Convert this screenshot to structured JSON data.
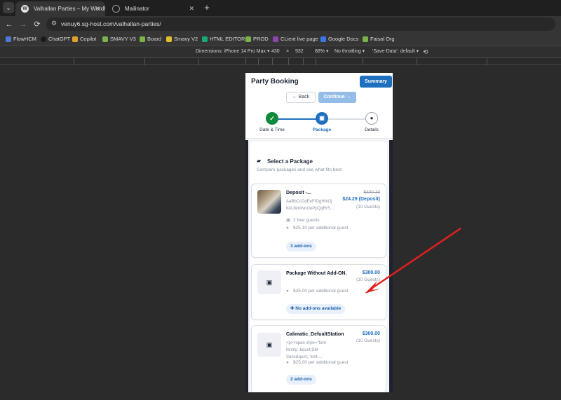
{
  "browser": {
    "tabs": [
      {
        "title": "Valhallan Parties – My WordPre",
        "icon": "wordpress-icon",
        "active": true
      },
      {
        "title": "Mailinator",
        "icon": "globe-icon",
        "active": false
      }
    ],
    "close_glyph": "✕",
    "new_tab_glyph": "+",
    "menu_glyph": "⌄",
    "url": "venuy6.sg-host.com/valhallan-parties/",
    "bookmarks": [
      {
        "label": "FlowHCM",
        "color": "#4b7bd6"
      },
      {
        "label": "ChatGPT",
        "color": "#1a1a1a"
      },
      {
        "label": "Copilot",
        "color": "#e0a02b"
      },
      {
        "label": "SMAVY V3",
        "color": "#7bb34a"
      },
      {
        "label": "Board",
        "color": "#7bb34a"
      },
      {
        "label": "Smavy V2",
        "color": "#e0c030"
      },
      {
        "label": "HTML EDITOR",
        "color": "#19a974"
      },
      {
        "label": "PROD",
        "color": "#7bb34a"
      },
      {
        "label": "CLient live page",
        "color": "#8e44ad"
      },
      {
        "label": "Google Docs",
        "color": "#3b78e7"
      },
      {
        "label": "Faisal Org",
        "color": "#7bb34a"
      }
    ]
  },
  "devtools": {
    "dimensions": "Dimensions: iPhone 14 Pro Max ▾",
    "width": "430",
    "times": "×",
    "height": "932",
    "zoom": "88% ▾",
    "throttle": "No throttling ▾",
    "save_data": "'Save-Data': default ▾"
  },
  "page": {
    "title": "Party Booking",
    "summary_button": "Summary",
    "back_button": "← Back",
    "continue_button": "Continue →",
    "steps": [
      {
        "label": "Date & Time",
        "state": "done"
      },
      {
        "label": "Package",
        "state": "active"
      },
      {
        "label": "Details",
        "state": "pending"
      }
    ],
    "section_title": "Select a Package",
    "section_subtitle": "Compare packages and see what fits best.",
    "packages": [
      {
        "name": "Deposit -...",
        "description": "AaBbCcDdEeFfGgHhIiJj KkLlMmNnOoPpQqRrS...",
        "old_price": "$300.10",
        "price": "$24.29 (Deposit)",
        "guests": "(10 Guests)",
        "free_guests": "2 free guests",
        "additional": "$25.10 per additional guest",
        "addons": "3 add-ons"
      },
      {
        "name": "Package Without Add-ON.",
        "price": "$300.00",
        "guests": "(10 Guests)",
        "additional": "$25.00 per additional guest",
        "addons": "No add-ons available"
      },
      {
        "name": "Calimatic_DefualtStation",
        "description": "<p><span style=\"font-family: &quot;DM Sans&quot;, font-...",
        "price": "$300.00",
        "guests": "(10 Guests)",
        "additional": "$25.00 per additional guest",
        "addons": "2 add-ons"
      }
    ]
  },
  "colors": {
    "accent": "#1f6fbf",
    "success": "#0f8a3c",
    "annotation_arrow": "#e02020"
  }
}
